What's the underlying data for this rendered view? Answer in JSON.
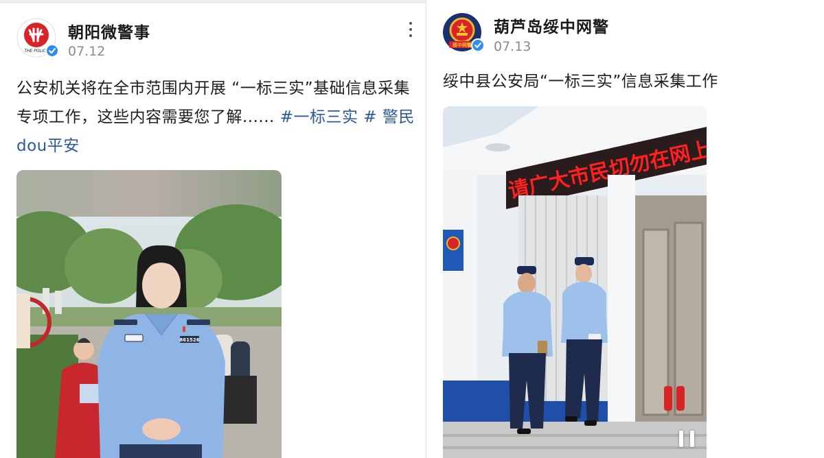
{
  "posts": [
    {
      "author": "朝阳微警事",
      "avatar_caption": "THE POLICE",
      "date": "07.12",
      "text_parts": [
        "公安机关将在全市范围内开展 “一标三实”基础信息采集专项工作，这些内容需要您了解......",
        "#一标三实 #",
        "警民dou平安"
      ],
      "media": {
        "badge_number": "861526"
      }
    },
    {
      "author": "葫芦岛绥中网警",
      "avatar_caption": "绥中网警",
      "date": "07.13",
      "text": "绥中县公安局“一标三实”信息采集工作",
      "media": {
        "led_banner": "请广大市民切勿在网上发布不..."
      }
    }
  ],
  "colors": {
    "link": "#2a5a9a",
    "verified": "#2f8cf0",
    "led_text": "#ff2020",
    "uniform": "#8fb4e6"
  },
  "icons": {
    "more": "more-vertical-icon",
    "verified": "verified-check-icon",
    "pause": "pause-icon"
  }
}
